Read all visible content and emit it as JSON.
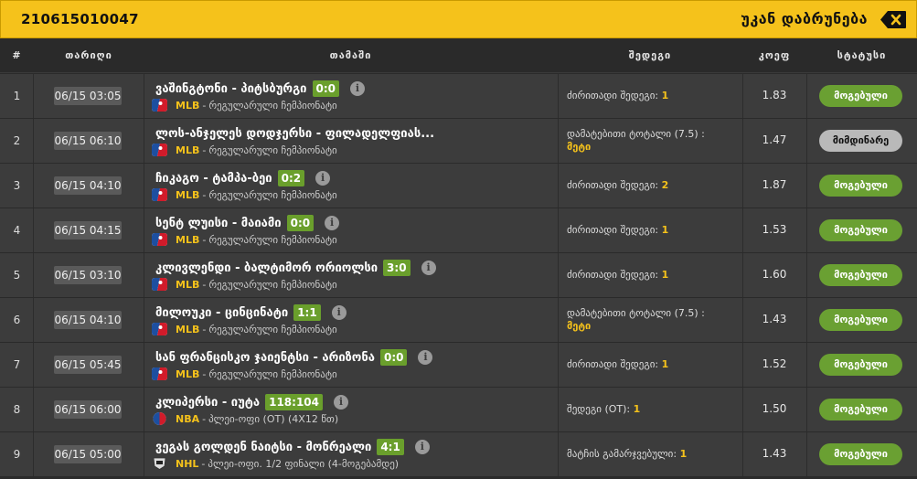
{
  "header": {
    "bet_id": "210615010047",
    "back_label": "უკან დაბრუნება",
    "back_icon": "backspace-icon"
  },
  "columns": {
    "num": "#",
    "date": "თარიღი",
    "match": "თამაში",
    "pick": "შედეგი",
    "odds": "კოეფ",
    "status": "სტატუსი"
  },
  "colors": {
    "accent": "#f5c21b",
    "won": "#6aa032",
    "pending": "#b9b9b9",
    "score": "#6a9f2c"
  },
  "rows": [
    {
      "num": "1",
      "date": "06/15 03:05",
      "match": "ვაშინგტონი - პიტსბურგი",
      "score": "0:0",
      "league": "MLB",
      "desc": "რეგულარული ჩემპიონატი",
      "pick_label": "ძირითადი შედეგი:",
      "pick_value": "1",
      "odds": "1.83",
      "status": "მოგებული"
    },
    {
      "num": "2",
      "date": "06/15 06:10",
      "match": "ლოს-ანჯელეს დოდჯერსი - ფილადელფიას...",
      "score": "",
      "league": "MLB",
      "desc": "რეგულარული ჩემპიონატი",
      "pick_label": "დამატებითი ტოტალი (7.5) :",
      "pick_value": "მეტი",
      "odds": "1.47",
      "status": "მიმდინარე"
    },
    {
      "num": "3",
      "date": "06/15 04:10",
      "match": "ჩიკაგო - ტამპა-ბეი",
      "score": "0:2",
      "league": "MLB",
      "desc": "რეგულარული ჩემპიონატი",
      "pick_label": "ძირითადი შედეგი:",
      "pick_value": "2",
      "odds": "1.87",
      "status": "მოგებული"
    },
    {
      "num": "4",
      "date": "06/15 04:15",
      "match": "სენტ ლუისი - მაიამი",
      "score": "0:0",
      "league": "MLB",
      "desc": "რეგულარული ჩემპიონატი",
      "pick_label": "ძირითადი შედეგი:",
      "pick_value": "1",
      "odds": "1.53",
      "status": "მოგებული"
    },
    {
      "num": "5",
      "date": "06/15 03:10",
      "match": "კლივლენდი - ბალტიმორ ორიოლსი",
      "score": "3:0",
      "league": "MLB",
      "desc": "რეგულარული ჩემპიონატი",
      "pick_label": "ძირითადი შედეგი:",
      "pick_value": "1",
      "odds": "1.60",
      "status": "მოგებული"
    },
    {
      "num": "6",
      "date": "06/15 04:10",
      "match": "მილოუკი - ცინცინატი",
      "score": "1:1",
      "league": "MLB",
      "desc": "რეგულარული ჩემპიონატი",
      "pick_label": "დამატებითი ტოტალი (7.5) :",
      "pick_value": "მეტი",
      "odds": "1.43",
      "status": "მოგებული"
    },
    {
      "num": "7",
      "date": "06/15 05:45",
      "match": "სან ფრანცისკო ჯაიენტსი - არიზონა",
      "score": "0:0",
      "league": "MLB",
      "desc": "რეგულარული ჩემპიონატი",
      "pick_label": "ძირითადი შედეგი:",
      "pick_value": "1",
      "odds": "1.52",
      "status": "მოგებული"
    },
    {
      "num": "8",
      "date": "06/15 06:00",
      "match": "კლიპერსი - იუტა",
      "score": "118:104",
      "league": "NBA",
      "desc": "პლეი-ოფი (OT) (4X12 წთ)",
      "pick_label": "შედეგი (OT):",
      "pick_value": "1",
      "odds": "1.50",
      "status": "მოგებული"
    },
    {
      "num": "9",
      "date": "06/15 05:00",
      "match": "ვეგას გოლდენ ნაიტსი - მონრეალი",
      "score": "4:1",
      "league": "NHL",
      "desc": "პლეი-ოფი. 1/2 ფინალი (4-მოგებამდე)",
      "pick_label": "მატჩის გამარჯვებული:",
      "pick_value": "1",
      "odds": "1.43",
      "status": "მოგებული"
    }
  ]
}
